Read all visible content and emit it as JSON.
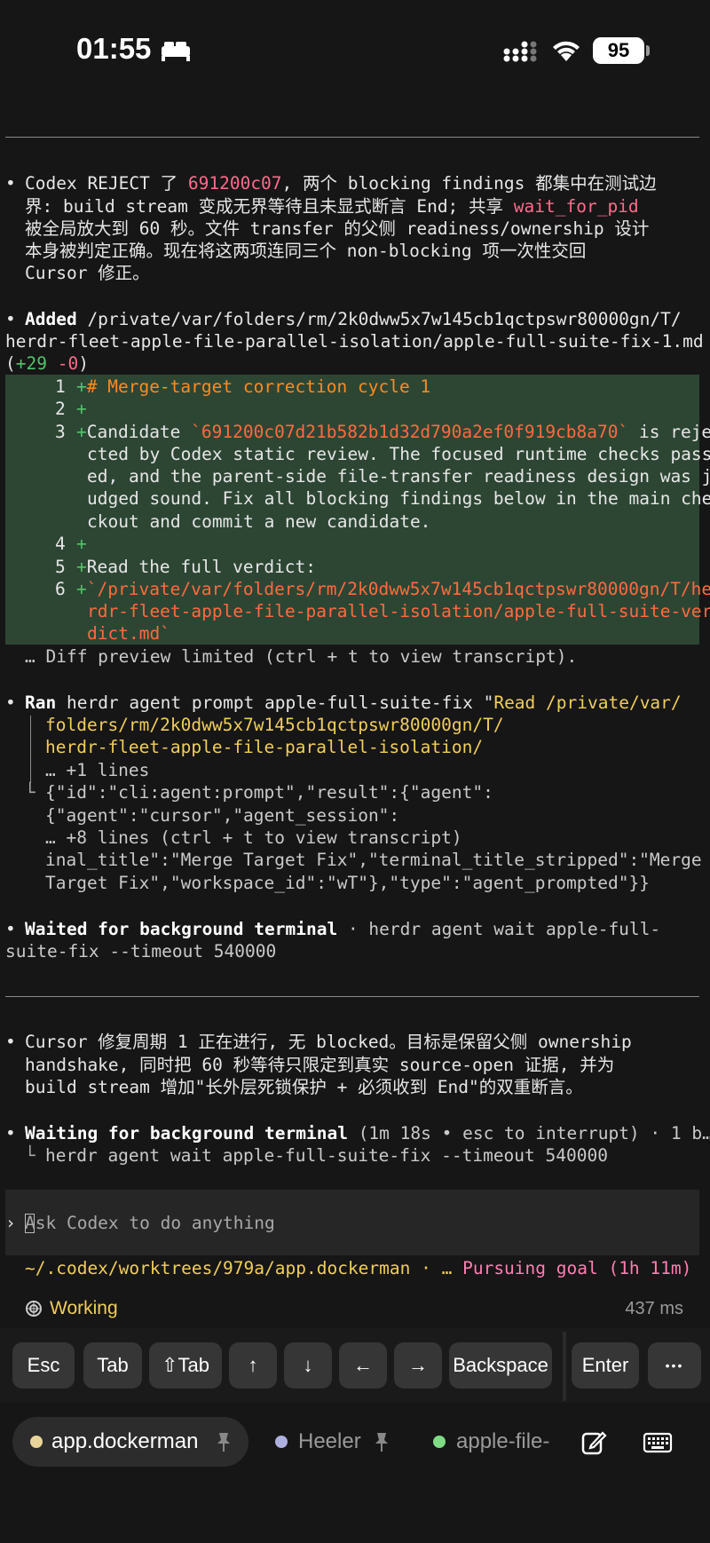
{
  "status_bar": {
    "time": "01:55",
    "battery": "95"
  },
  "messages": {
    "m1": {
      "l1a": "Codex REJECT 了 ",
      "l1b": "691200c07",
      "l1c": ", 两个 blocking findings 都集中在测试边",
      "l2a": "界: build stream 变成无界等待且未显式断言 End; 共享 ",
      "l2b": "wait_for_pid",
      "l3": "被全局放大到 60 秒。文件 transfer 的父侧 readiness/ownership 设计",
      "l4": "本身被判定正确。现在将这两项连同三个 non-blocking 项一次性交回",
      "l5": "Cursor 修正。"
    },
    "added": {
      "verb": "Added",
      "path1": " /private/var/folders/rm/2k0dww5x7w145cb1qctpswr80000gn/T/",
      "path2": "herdr-fleet-apple-file-parallel-isolation/apple-full-suite-fix-1.md",
      "stat_open": "(",
      "stat_plus": "+29",
      "stat_minus": " -0",
      "stat_close": ")"
    },
    "diff": {
      "r1n": "1",
      "r1": "# Merge-target correction cycle 1",
      "r2n": "2",
      "r3n": "3",
      "r3a": "Candidate ",
      "r3b": "`691200c07d21b582b1d32d790a2ef0f919cb8a70`",
      "r3c": " is reje",
      "r3l2": "cted by Codex static review. The focused runtime checks pass",
      "r3l3": "ed, and the parent-side file-transfer readiness design was j",
      "r3l4": "udged sound. Fix all blocking findings below in the main che",
      "r3l5": "ckout and commit a new candidate.",
      "r4n": "4",
      "r5n": "5",
      "r5": "Read the full verdict:",
      "r6n": "6",
      "r6l1": "`/private/var/folders/rm/2k0dww5x7w145cb1qctpswr80000gn/T/he",
      "r6l2": "rdr-fleet-apple-file-parallel-isolation/apple-full-suite-ver",
      "r6l3": "dict.md`",
      "plus": "+",
      "preview": "… Diff preview limited (ctrl + t to view transcript)."
    },
    "ran": {
      "verb": "Ran",
      "cmd": " herdr agent prompt apple-full-suite-fix \"",
      "y1": "Read /private/var/",
      "y2": "folders/rm/2k0dww5x7w145cb1qctpswr80000gn/T/",
      "y3": "herdr-fleet-apple-file-parallel-isolation/",
      "more1": "… +1 lines",
      "o1": "{\"id\":\"cli:agent:prompt\",\"result\":{\"agent\":",
      "o2": "{\"agent\":\"cursor\",\"agent_session\":",
      "more2": "… +8 lines (ctrl + t to view transcript)",
      "o3": "inal_title\":\"Merge Target Fix\",\"terminal_title_stripped\":\"Merge",
      "o4": "Target Fix\",\"workspace_id\":\"wT\"},\"type\":\"agent_prompted\"}}"
    },
    "waited": {
      "label": "Waited for background terminal",
      "rest": " · herdr agent wait apple-full-",
      "rest2": "suite-fix --timeout 540000"
    },
    "m2": {
      "l1": "Cursor 修复周期 1 正在进行, 无 blocked。目标是保留父侧 ownership",
      "l2": "handshake, 同时把 60 秒等待只限定到真实 source-open 证据, 并为",
      "l3": "build stream 增加\"长外层死锁保护 + 必须收到 End\"的双重断言。"
    },
    "waiting": {
      "label": "Waiting for background terminal",
      "meta": " (1m 18s • esc to interrupt) · 1 b…",
      "cmd": "herdr agent wait apple-full-suite-fix --timeout 540000"
    }
  },
  "composer": {
    "placeholder": "Ask Codex to do anything",
    "path": "~/.codex/worktrees/979a/app.dockerman · … ",
    "goal": "Pursuing goal (1h 11m)",
    "status": "Working",
    "elapsed": "437 ms"
  },
  "keys": {
    "esc": "Esc",
    "tab": "Tab",
    "shift_tab": "⇧Tab",
    "up": "↑",
    "down": "↓",
    "left": "←",
    "right": "→",
    "backspace": "Backspace",
    "enter": "Enter",
    "more": "•••"
  },
  "tabs": [
    {
      "label": "app.dockerman",
      "color": "#e8d49a"
    },
    {
      "label": "Heeler",
      "color": "#aeb0e0"
    },
    {
      "label": "apple-file-",
      "color": "#7fdc85"
    }
  ]
}
